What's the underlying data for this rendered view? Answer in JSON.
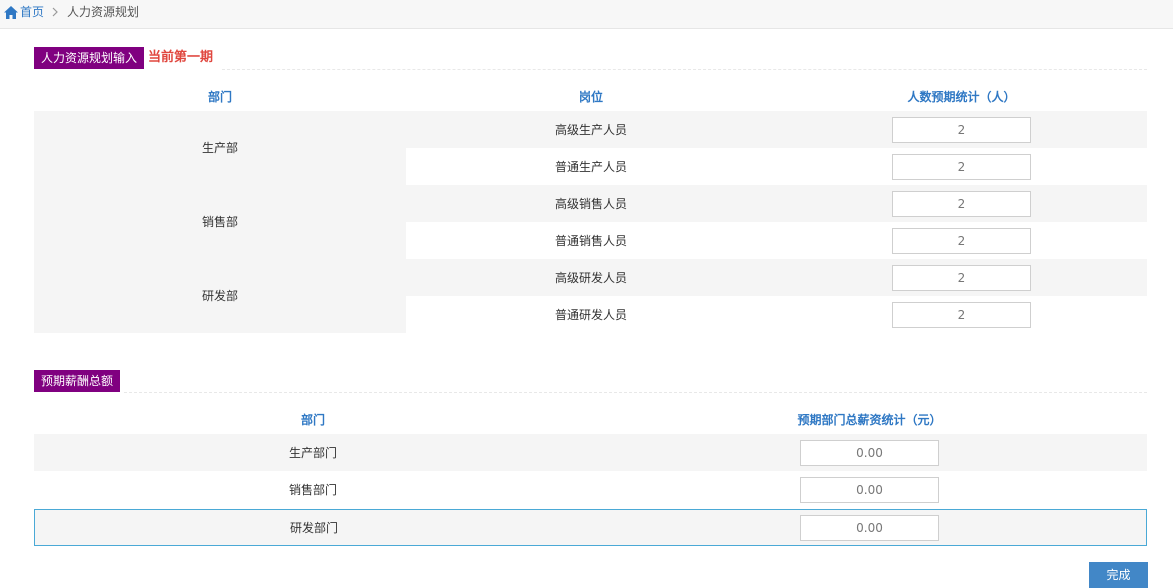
{
  "breadcrumb": {
    "home": "首页",
    "current": "人力资源规划"
  },
  "planning": {
    "title": "人力资源规划输入",
    "period_note": "当前第一期",
    "headers": {
      "dept": "部门",
      "position": "岗位",
      "count": "人数预期统计（人）"
    },
    "departments": [
      {
        "name": "生产部",
        "positions": [
          {
            "name": "高级生产人员",
            "count": "2"
          },
          {
            "name": "普通生产人员",
            "count": "2"
          }
        ]
      },
      {
        "name": "销售部",
        "positions": [
          {
            "name": "高级销售人员",
            "count": "2"
          },
          {
            "name": "普通销售人员",
            "count": "2"
          }
        ]
      },
      {
        "name": "研发部",
        "positions": [
          {
            "name": "高级研发人员",
            "count": "2"
          },
          {
            "name": "普通研发人员",
            "count": "2"
          }
        ]
      }
    ]
  },
  "salary": {
    "title": "预期薪酬总额",
    "headers": {
      "dept": "部门",
      "total": "预期部门总薪资统计（元）"
    },
    "rows": [
      {
        "dept": "生产部门",
        "total": "0.00"
      },
      {
        "dept": "销售部门",
        "total": "0.00"
      },
      {
        "dept": "研发部门",
        "total": "0.00"
      }
    ]
  },
  "actions": {
    "done_label": "完成"
  },
  "colors": {
    "section_title_bg": "#800080",
    "accent_blue": "#2f78c4",
    "period_red": "#e0473f",
    "button_blue": "#4287c7",
    "row_shade": "#f5f5f5",
    "selected_border": "#4aa9d6"
  },
  "icons": {
    "home": "home-icon",
    "separator": "chevron-right-icon"
  }
}
